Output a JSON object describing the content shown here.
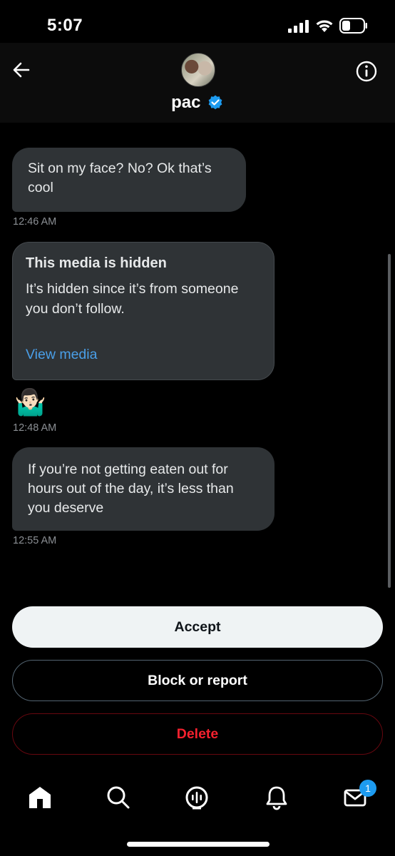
{
  "status_bar": {
    "time": "5:07"
  },
  "header": {
    "name": "pac",
    "avatar_icon": "profile-photo",
    "verified_icon": "verified-badge-icon",
    "back_icon": "arrow-left-icon",
    "info_icon": "info-icon"
  },
  "messages": [
    {
      "text": "Sit on my face? No? Ok that’s cool",
      "time": "12:46 AM"
    },
    {
      "hidden_title": "This media is hidden",
      "hidden_body": "It’s hidden since it’s from someone you don’t follow.",
      "hidden_link": "View media"
    },
    {
      "emoji": "🤷🏻‍♂️",
      "time": "12:48 AM"
    },
    {
      "text": "If you’re not getting eaten out for hours out of the day, it’s less than you deserve",
      "time": "12:55 AM"
    }
  ],
  "actions": {
    "accept": "Accept",
    "block": "Block or report",
    "delete": "Delete"
  },
  "tab_bar": {
    "items": [
      "home-icon",
      "search-icon",
      "spaces-icon",
      "notifications-icon",
      "messages-icon"
    ],
    "messages_badge": "1"
  },
  "colors": {
    "accent": "#1d9bf0",
    "delete": "#f4212e",
    "bubble": "#2f3336"
  }
}
